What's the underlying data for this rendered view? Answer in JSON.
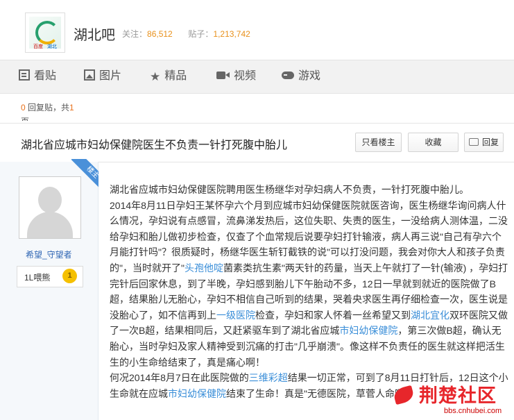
{
  "forum": {
    "logo_text_left": "百度",
    "logo_text_right": "湖北",
    "name": "湖北吧",
    "follow_label": "关注：",
    "follow_count": "86,512",
    "posts_label": "贴子：",
    "posts_count": "1,213,742"
  },
  "nav": {
    "items": [
      {
        "label": "看贴",
        "icon": "doc-icon"
      },
      {
        "label": "图片",
        "icon": "image-icon"
      },
      {
        "label": "精品",
        "icon": "star-icon"
      },
      {
        "label": "视频",
        "icon": "video-icon"
      },
      {
        "label": "游戏",
        "icon": "gamepad-icon"
      }
    ],
    "star_glyph": "★"
  },
  "reply_info": {
    "count": "0",
    "text_mid": "回复贴，共",
    "pages": "1",
    "text_end": "页"
  },
  "thread": {
    "title": "湖北省应城市妇幼保健院医生不负责一针打死腹中胎儿",
    "only_op_button": "只看楼主",
    "favorite_button": "收藏",
    "reply_button": "回复"
  },
  "author": {
    "ribbon": "楼主",
    "name": "希望_守望者",
    "level_title": "1L喂熊",
    "level": "1"
  },
  "post": {
    "p1": "湖北省应城市妇幼保健医院聘用医生杨继华对孕妇病人不负责，一针打死腹中胎儿。",
    "p2a": "2014年8月11日孕妇王某怀孕六个月到应城市妇幼保健医院就医咨询，医生杨继华询问病人什么情况，孕妇说有点感冒，流鼻涕发热后，这位失职、失责的医生，一没给病人测体温，二没给孕妇和胎儿做初步检查，仅查了个血常规后说要孕妇打针输液，病人再三说\"自己有孕六个月能打针吗\"？很质疑时，杨继华医生斩钉截铁的说\"可以打没问题，我会对你大人和孩子负责的\"，当时就开了\"",
    "p2_link1": "头孢他啶",
    "p2b": "菌素类抗生素\"两天针的药量，当天上午就打了一针(输液) ，孕妇打完针后回家休息，到了半晚，孕妇感到胎儿下午胎动不多，12日一早就到就近的医院做了B超，结果胎儿无胎心，孕妇不相信自己听到的结果，哭着央求医生再仔细检查一次，医生说是没胎心了，如不信再到上",
    "p2_link2": "一级医院",
    "p2c": "检查，孕妇和家人怀着一丝希望又到",
    "p2_link3": "湖北宜化",
    "p2d": "双环医院又做了一次B超，结果相同后，又赶紧驱车到了湖北省应城",
    "p2_link4": "市妇幼保健院",
    "p2e": "，第三次做B超，确认无胎心，当时孕妇及家人精神受到沉痛的打击\"几乎崩溃\"。像这样不负责任的医生就这样把活生生的小生命给结束了，真是痛心啊！",
    "p3a": "何况2014年8月7日在此医院做的",
    "p3_link1": "三维彩超",
    "p3b": "结果一切正常，可到了8月11日打针后，12日这个小生命就在应城",
    "p3_link2": "市妇幼保健院",
    "p3c": "结束了生命！真是\"无德医院，草菅人命啊！"
  },
  "watermark": {
    "text": "荆楚社区",
    "url": "bbs.cnhubei.com"
  }
}
